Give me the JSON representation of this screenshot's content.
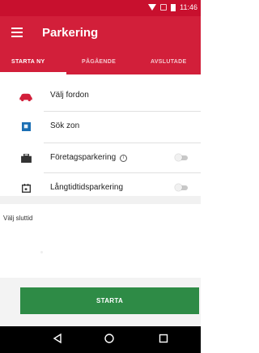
{
  "status": {
    "time": "11:46"
  },
  "app": {
    "title": "Parkering"
  },
  "tabs": [
    {
      "label": "STARTA NY"
    },
    {
      "label": "PÅGÅENDE"
    },
    {
      "label": "AVSLUTADE"
    }
  ],
  "rows": [
    {
      "label": "Välj fordon",
      "icon": "car-icon"
    },
    {
      "label": "Sök zon",
      "icon": "parking-sign-icon"
    },
    {
      "label": "Företagsparkering",
      "icon": "briefcase-icon",
      "toggle": false
    },
    {
      "label": "Långtidtidsparkering",
      "icon": "calendar-icon",
      "toggle": false
    }
  ],
  "endtime": {
    "label": "Välj sluttid"
  },
  "actions": {
    "start_label": "STARTA"
  },
  "colors": {
    "header": "#d21f3a",
    "primary_button": "#2e8b46",
    "car_icon": "#d21f3a",
    "zone_icon": "#1b6fb4"
  }
}
